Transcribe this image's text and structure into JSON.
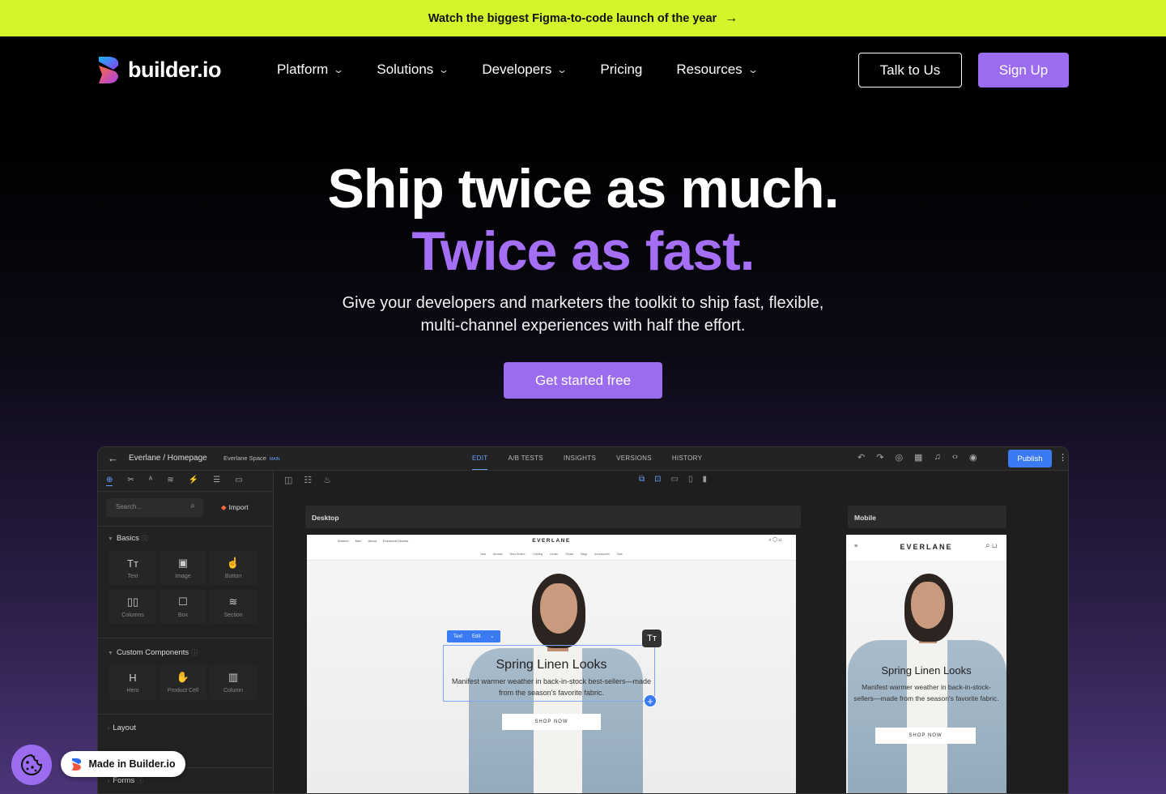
{
  "announcement": {
    "text": "Watch the biggest Figma-to-code launch of the year",
    "arrow": "→"
  },
  "nav": {
    "logo_text": "builder.io",
    "items": [
      {
        "label": "Platform",
        "has_dropdown": true
      },
      {
        "label": "Solutions",
        "has_dropdown": true
      },
      {
        "label": "Developers",
        "has_dropdown": true
      },
      {
        "label": "Pricing",
        "has_dropdown": false
      },
      {
        "label": "Resources",
        "has_dropdown": true
      }
    ],
    "talk_label": "Talk to Us",
    "signup_label": "Sign Up"
  },
  "hero": {
    "headline_1": "Ship twice as much.",
    "headline_2": "Twice as fast.",
    "subtitle": "Give your developers and marketers the toolkit to ship fast, flexible, multi-channel experiences with half the effort.",
    "cta_label": "Get started free"
  },
  "app": {
    "breadcrumb": "Everlane / Homepage",
    "space": "Everlane Space",
    "space_tag": "MAIN",
    "tabs": [
      "EDIT",
      "A/B TESTS",
      "INSIGHTS",
      "VERSIONS",
      "HISTORY"
    ],
    "active_tab": "EDIT",
    "publish_label": "Publish",
    "search_placeholder": "Search...",
    "import_label": "Import",
    "basics_label": "Basics",
    "basics": [
      {
        "icon": "text-icon",
        "glyph": "Tт",
        "label": "Text"
      },
      {
        "icon": "image-icon",
        "glyph": "▣",
        "label": "Image"
      },
      {
        "icon": "button-icon",
        "glyph": "☝",
        "label": "Button"
      },
      {
        "icon": "columns-icon",
        "glyph": "▯▯",
        "label": "Columns"
      },
      {
        "icon": "box-icon",
        "glyph": "☐",
        "label": "Box"
      },
      {
        "icon": "section-icon",
        "glyph": "≋",
        "label": "Section"
      }
    ],
    "custom_label": "Custom Components",
    "custom": [
      {
        "icon": "hero-icon",
        "glyph": "H",
        "label": "Hero"
      },
      {
        "icon": "product-cell-icon",
        "glyph": "✋",
        "label": "Product Cell"
      },
      {
        "icon": "column-icon",
        "glyph": "▥",
        "label": "Column"
      }
    ],
    "layout_label": "Layout",
    "forms_label": "Forms",
    "desktop_label": "Desktop",
    "mobile_label": "Mobile",
    "site": {
      "brand": "EVERLANE",
      "nav_links": [
        "Women",
        "Men",
        "About",
        "Everworld Stories"
      ],
      "categories": "New Arrivals  Best-Sellers  Clothing  Denim  Shoes  Bags  Accessories  Sale",
      "title": "Spring Linen Looks",
      "body_desktop": "Manifest warmer weather in back-in-stock best-sellers—made from the season's favorite fabric.",
      "body_mobile": "Manifest warmer weather in back-in-stock-sellers—made from the season's favorite fabric.",
      "shop_label": "SHOP NOW",
      "toolbar_text": "Text",
      "toolbar_edit": "Edit"
    }
  },
  "widgets": {
    "made_in": "Made in Builder.io"
  },
  "colors": {
    "accent": "#9b6cf0",
    "announcement_bg": "#d4f52b",
    "editor_blue": "#3a7bf5"
  }
}
